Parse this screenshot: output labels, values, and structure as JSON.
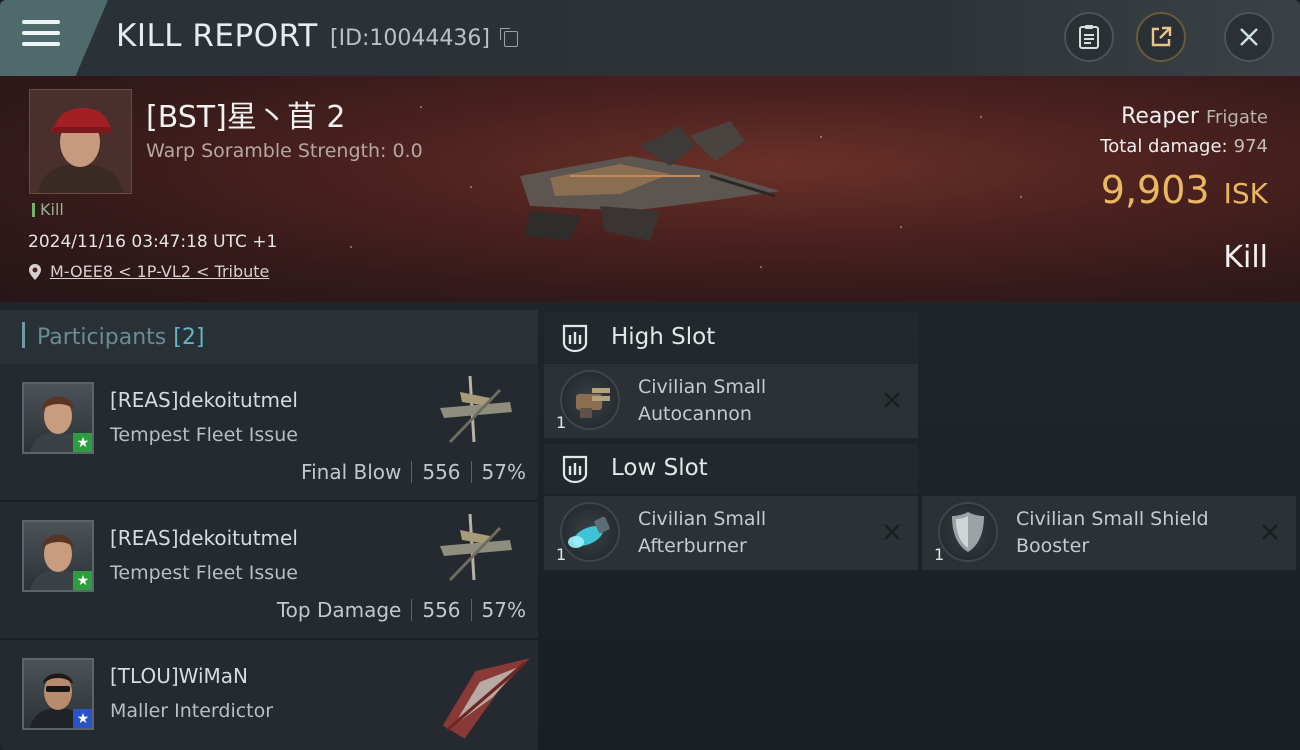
{
  "header": {
    "title": "KILL REPORT",
    "report_id": "[ID:10044436]"
  },
  "victim": {
    "name": "[BST]星丶苜 2",
    "warp_scramble": "Warp Soramble Strength: 0.0",
    "tag": "Kill",
    "timestamp": "2024/11/16 03:47:18 UTC +1",
    "location": "M-OEE8 < 1P-VL2 < Tribute",
    "ship_name": "Reaper",
    "ship_class": "Frigate",
    "total_damage_label": "Total damage:",
    "total_damage": "974",
    "isk_value": "9,903",
    "isk_unit": "ISK",
    "result": "Kill"
  },
  "participants": {
    "title": "Participants",
    "count": "[2]",
    "rows": [
      {
        "name": "[REAS]dekoitutmel",
        "ship": "Tempest Fleet Issue",
        "role": "Final Blow",
        "damage": "556",
        "percent": "57%",
        "badge": "★"
      },
      {
        "name": "[REAS]dekoitutmel",
        "ship": "Tempest Fleet Issue",
        "role": "Top Damage",
        "damage": "556",
        "percent": "57%",
        "badge": "★"
      },
      {
        "name": "[TLOU]WiMaN",
        "ship": "Maller Interdictor",
        "badge": "★"
      }
    ]
  },
  "fitting": {
    "high_slot": {
      "title": "High Slot",
      "modules": [
        {
          "name_line1": "Civilian Small",
          "name_line2": "Autocannon",
          "qty": "1"
        }
      ]
    },
    "low_slot": {
      "title": "Low Slot",
      "modules": [
        {
          "name_line1": "Civilian Small",
          "name_line2": "Afterburner",
          "qty": "1"
        },
        {
          "name_line1": "Civilian Small Shield",
          "name_line2": "Booster",
          "qty": "1"
        }
      ]
    }
  },
  "colors": {
    "isk_gold": "#e9b860",
    "accent_teal": "#5eb8c3",
    "badge_green": "#2c9e3e",
    "badge_blue": "#2a52c9"
  }
}
